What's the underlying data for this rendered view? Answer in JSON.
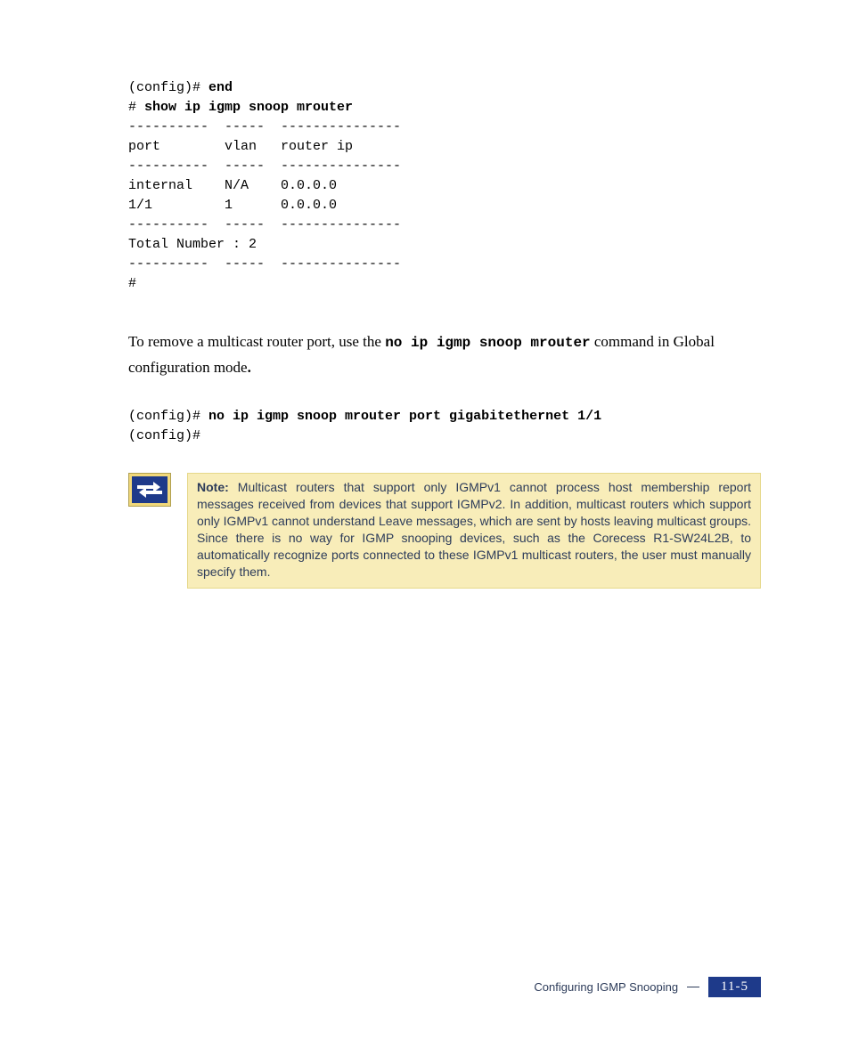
{
  "code1": {
    "l1a": "(config)# ",
    "l1b": "end",
    "l2a": "# ",
    "l2b": "show ip igmp snoop mrouter",
    "l3": "----------  -----  ---------------",
    "l4": "port        vlan   router ip",
    "l5": "----------  -----  ---------------",
    "l6": "internal    N/A    0.0.0.0",
    "l7": "1/1         1      0.0.0.0",
    "l8": "----------  -----  ---------------",
    "l9": "Total Number : 2",
    "l10": "----------  -----  ---------------",
    "l11": "#"
  },
  "para": {
    "t1": "To remove a multicast router port, use the ",
    "cmd": "no ip igmp snoop mrouter",
    "t2": " command in Global configuration mode",
    "t3": "."
  },
  "code2": {
    "l1a": "(config)# ",
    "l1b": "no ip igmp snoop mrouter port gigabitethernet 1/1",
    "l2": "(config)#"
  },
  "note": {
    "label": "Note:",
    "body": " Multicast routers that support only IGMPv1 cannot process host membership report messages received from devices that support IGMPv2. In addition, multicast routers which support only IGMPv1 cannot understand Leave messages, which are sent by hosts leaving multicast groups. Since there is no way for IGMP snooping devices, such as the Corecess R1-SW24L2B, to automatically recognize ports connected to these IGMPv1 multicast routers, the user must manually specify them."
  },
  "footer": {
    "text": "Configuring IGMP Snooping",
    "page": "11-5"
  }
}
